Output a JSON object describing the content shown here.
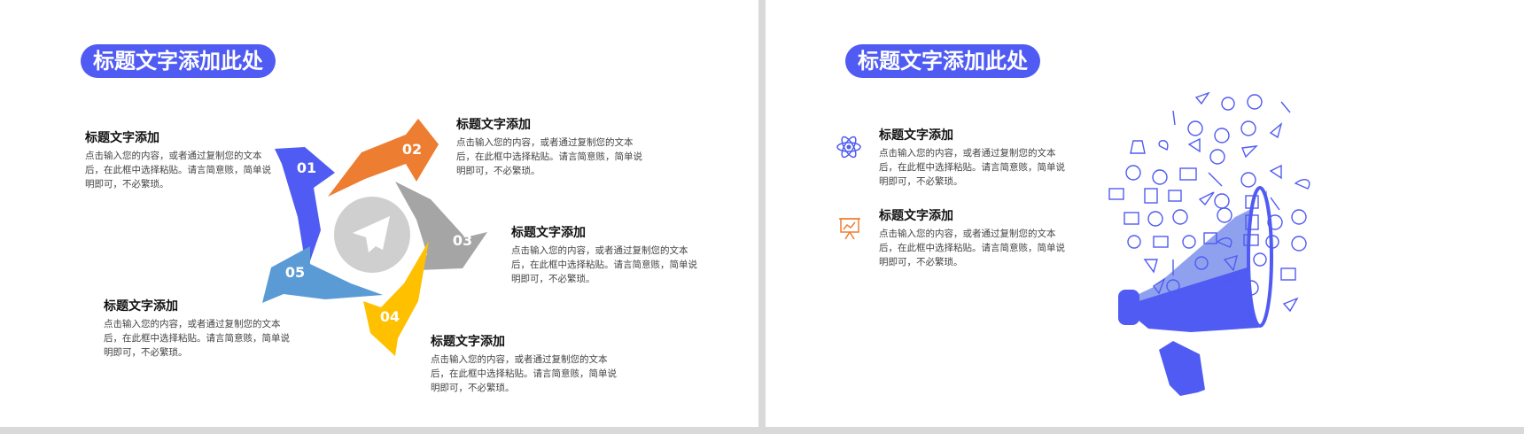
{
  "left_slide": {
    "title": "标题文字添加此处",
    "steps": [
      {
        "number": "01",
        "title": "标题文字添加",
        "body": "点击输入您的内容，或者通过复制您的文本后，在此框中选择粘贴。请言简意赅，简单说明即可，不必繁琐。"
      },
      {
        "number": "02",
        "title": "标题文字添加",
        "body": "点击输入您的内容，或者通过复制您的文本后，在此框中选择粘贴。请言简意赅，简单说明即可，不必繁琐。"
      },
      {
        "number": "03",
        "title": "标题文字添加",
        "body": "点击输入您的内容，或者通过复制您的文本后，在此框中选择粘贴。请言简意赅，简单说明即可，不必繁琐。"
      },
      {
        "number": "04",
        "title": "标题文字添加",
        "body": "点击输入您的内容，或者通过复制您的文本后，在此框中选择粘贴。请言简意赅，简单说明即可，不必繁琐。"
      },
      {
        "number": "05",
        "title": "标题文字添加",
        "body": "点击输入您的内容，或者通过复制您的文本后，在此框中选择粘贴。请言简意赅，简单说明即可，不必繁琐。"
      }
    ],
    "center_icon": "paper-plane-icon",
    "colors": {
      "c01": "#4f5bf2",
      "c02": "#ed7d31",
      "c03": "#a5a5a5",
      "c04": "#ffc000",
      "c05": "#5b9bd5"
    }
  },
  "right_slide": {
    "title": "标题文字添加此处",
    "items": [
      {
        "icon": "atom-icon",
        "title": "标题文字添加",
        "body": "点击输入您的内容，或者通过复制您的文本后，在此框中选择粘贴。请言简意赅，简单说明即可，不必繁琐。"
      },
      {
        "icon": "presentation-board-icon",
        "title": "标题文字添加",
        "body": "点击输入您的内容，或者通过复制您的文本后，在此框中选择粘贴。请言简意赅，简单说明即可，不必繁琐。"
      }
    ],
    "illustration": "megaphone-with-social-icons",
    "accent": "#4f5bf2"
  }
}
